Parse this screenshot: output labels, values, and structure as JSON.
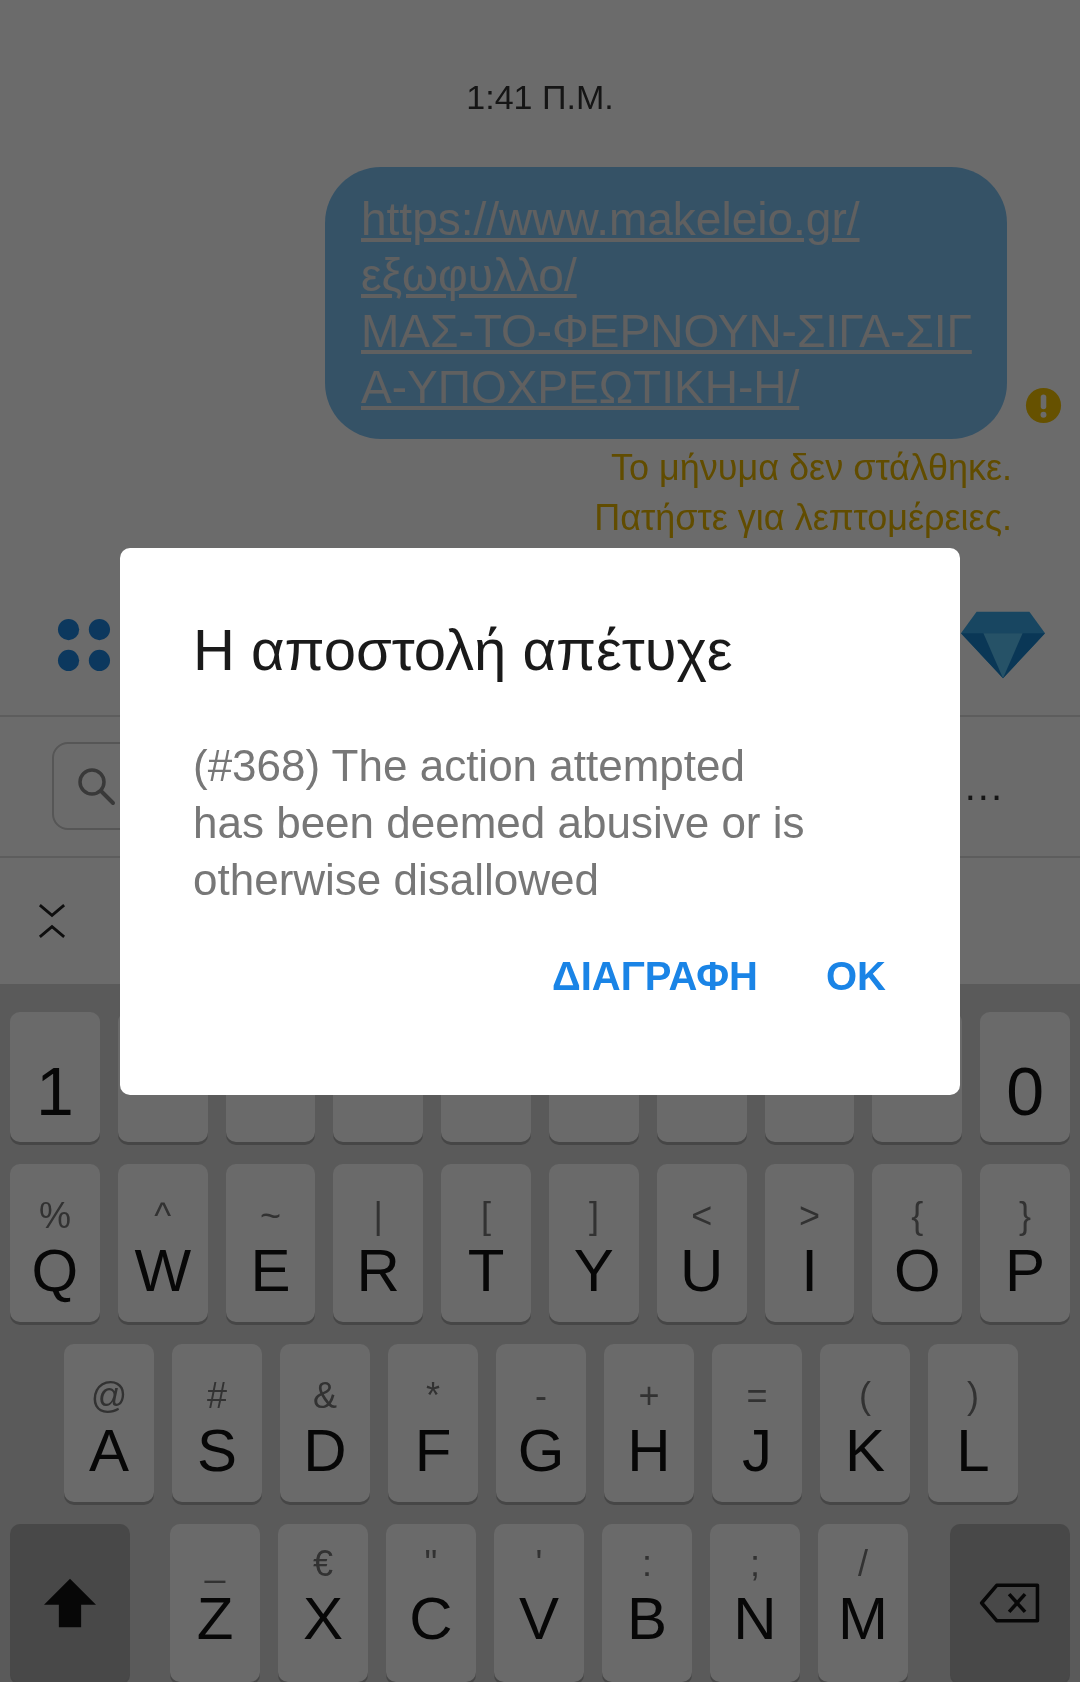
{
  "chat": {
    "timestamp": "1:41 Π.Μ.",
    "message": {
      "lines": [
        "https://www.makeleio.gr/",
        "εξωφυλλο/",
        "ΜΑΣ-ΤΟ-ΦΕΡΝΟΥΝ-ΣΙΓΑ-ΣΙΓ",
        "Α-ΥΠΟΧΡΕΩΤΙΚΗ-Η/"
      ],
      "failed": true
    },
    "error_lines": [
      "Το μήνυμα δεν στάλθηκε.",
      "Πατήστε για λεπτομέρειες."
    ]
  },
  "toolbar": {
    "more": "..."
  },
  "keyboard": {
    "rows": [
      [
        {
          "kind": "key",
          "main": "1"
        },
        {
          "kind": "key"
        },
        {
          "kind": "key"
        },
        {
          "kind": "key"
        },
        {
          "kind": "key"
        },
        {
          "kind": "key"
        },
        {
          "kind": "key"
        },
        {
          "kind": "key"
        },
        {
          "kind": "key"
        },
        {
          "kind": "key",
          "main": "0"
        }
      ],
      [
        {
          "kind": "key",
          "alt": "%",
          "main": "Q"
        },
        {
          "kind": "key",
          "alt": "^",
          "main": "W"
        },
        {
          "kind": "key",
          "alt": "~",
          "main": "E"
        },
        {
          "kind": "key",
          "alt": "|",
          "main": "R"
        },
        {
          "kind": "key",
          "alt": "[",
          "main": "T"
        },
        {
          "kind": "key",
          "alt": "]",
          "main": "Y"
        },
        {
          "kind": "key",
          "alt": "<",
          "main": "U"
        },
        {
          "kind": "key",
          "alt": ">",
          "main": "I"
        },
        {
          "kind": "key",
          "alt": "{",
          "main": "O"
        },
        {
          "kind": "key",
          "alt": "}",
          "main": "P"
        }
      ],
      [
        {
          "kind": "key",
          "alt": "@",
          "main": "A"
        },
        {
          "kind": "key",
          "alt": "#",
          "main": "S"
        },
        {
          "kind": "key",
          "alt": "&",
          "main": "D"
        },
        {
          "kind": "key",
          "alt": "*",
          "main": "F"
        },
        {
          "kind": "key",
          "alt": "-",
          "main": "G"
        },
        {
          "kind": "key",
          "alt": "+",
          "main": "H"
        },
        {
          "kind": "key",
          "alt": "=",
          "main": "J"
        },
        {
          "kind": "key",
          "alt": "(",
          "main": "K"
        },
        {
          "kind": "key",
          "alt": ")",
          "main": "L"
        }
      ],
      [
        {
          "kind": "shift"
        },
        {
          "kind": "key",
          "alt": "_",
          "main": "Z"
        },
        {
          "kind": "key",
          "alt": "€",
          "main": "X"
        },
        {
          "kind": "key",
          "alt": "\"",
          "main": "C"
        },
        {
          "kind": "key",
          "alt": "'",
          "main": "V"
        },
        {
          "kind": "key",
          "alt": ":",
          "main": "B"
        },
        {
          "kind": "key",
          "alt": ";",
          "main": "N"
        },
        {
          "kind": "key",
          "alt": "/",
          "main": "M"
        },
        {
          "kind": "backspace"
        }
      ]
    ]
  },
  "dialog": {
    "title": "Η αποστολή απέτυχε",
    "message": "(#368) The action attempted has been deemed abusive or is otherwise disallowed",
    "buttons": [
      "ΔΙΑΓΡΑΦΗ",
      "OK"
    ]
  }
}
